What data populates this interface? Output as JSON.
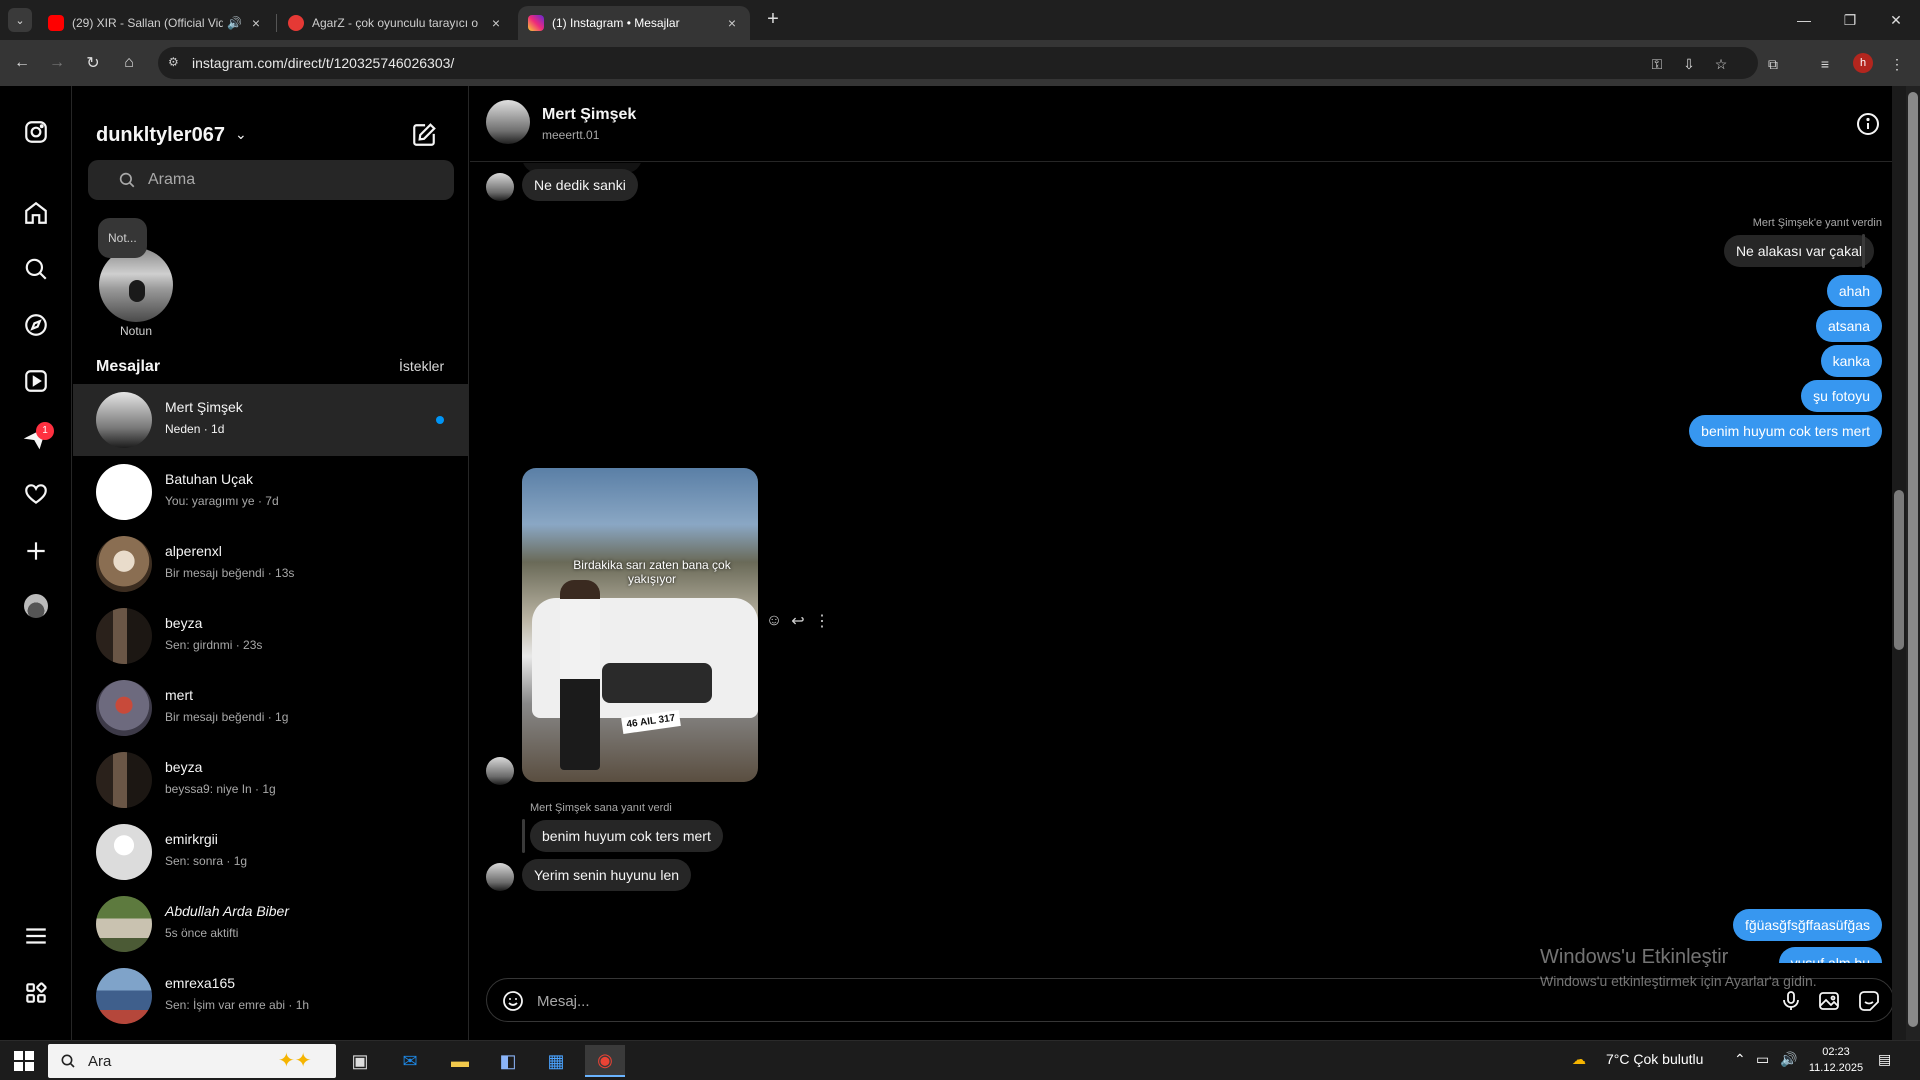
{
  "browser": {
    "tabs": [
      {
        "title": "(29) XIR - Sallan (Official Vid",
        "favicon_color": "#ff0000",
        "has_audio": true
      },
      {
        "title": "AgarZ - çok oyunculu tarayıcı o",
        "favicon_color": "#e53935",
        "has_audio": false
      },
      {
        "title": "(1) Instagram • Mesajlar",
        "favicon_color": "#d62976",
        "has_audio": false
      }
    ],
    "url": "instagram.com/direct/t/120325746026303/",
    "profile_initial": "h"
  },
  "instagram": {
    "username": "dunkltyler067",
    "search": {
      "placeholder": "Arama"
    },
    "note": {
      "bubble": "Not...",
      "label": "Notun"
    },
    "section_title": "Mesajlar",
    "requests_label": "İstekler",
    "rail_badge": "1",
    "threads": [
      {
        "name": "Mert Şimşek",
        "preview": "Neden · 1d",
        "unread": true,
        "italic": false
      },
      {
        "name": "Batuhan Uçak",
        "preview": "You: yaragımı ye · 7d",
        "unread": false,
        "italic": false
      },
      {
        "name": "alperenxl",
        "preview": "Bir mesajı beğendi · 13s",
        "unread": false,
        "italic": false
      },
      {
        "name": "beyza",
        "preview": "Sen: girdnmi · 23s",
        "unread": false,
        "italic": false
      },
      {
        "name": "mert",
        "preview": "Bir mesajı beğendi · 1g",
        "unread": false,
        "italic": false
      },
      {
        "name": "beyza",
        "preview": "beyssa9: niye In · 1g",
        "unread": false,
        "italic": false
      },
      {
        "name": "emirkrgii",
        "preview": "Sen: sonra · 1g",
        "unread": false,
        "italic": false
      },
      {
        "name": "Abdullah Arda Biber",
        "preview": "5s önce aktifti",
        "unread": false,
        "italic": true
      },
      {
        "name": "emrexa165",
        "preview": "Sen: İşim var emre abi · 1h",
        "unread": false,
        "italic": false
      }
    ],
    "chat": {
      "name": "Mert Şimşek",
      "handle": "meeertt.01",
      "messages": {
        "in1": "Ne dedik sanki",
        "reply_meta_out": "Mert Şimşek'e yanıt verdin",
        "reply_quote_out": "Ne alakası var çakal",
        "out1": "ahah",
        "out2": "atsana",
        "out3": "kanka",
        "out4": "şu fotoyu",
        "out5": "benim huyum cok ters mert",
        "photo_caption": "Birdakika sarı zaten bana çok yakışıyor",
        "photo_plate": "46 AIL 317",
        "reply_meta_in": "Mert Şimşek sana yanıt verdi",
        "reply_quote_in": "benim huyum cok ters mert",
        "in2": "Yerim senin huyunu len",
        "out6": "fğüasğfsğffaasüfğas",
        "out7": "yusuf alm bu"
      },
      "composer_placeholder": "Mesaj..."
    }
  },
  "watermark": {
    "line1": "Windows'u Etkinleştir",
    "line2": "Windows'u etkinleştirmek için Ayarlar'a gidin."
  },
  "taskbar": {
    "search_text": "Ara",
    "weather": "7°C  Çok bulutlu",
    "time": "02:23",
    "date": "11.12.2025"
  },
  "colors": {
    "accent_blue": "#3797f0",
    "unread_dot": "#0095f6",
    "badge_red": "#ff3040"
  }
}
